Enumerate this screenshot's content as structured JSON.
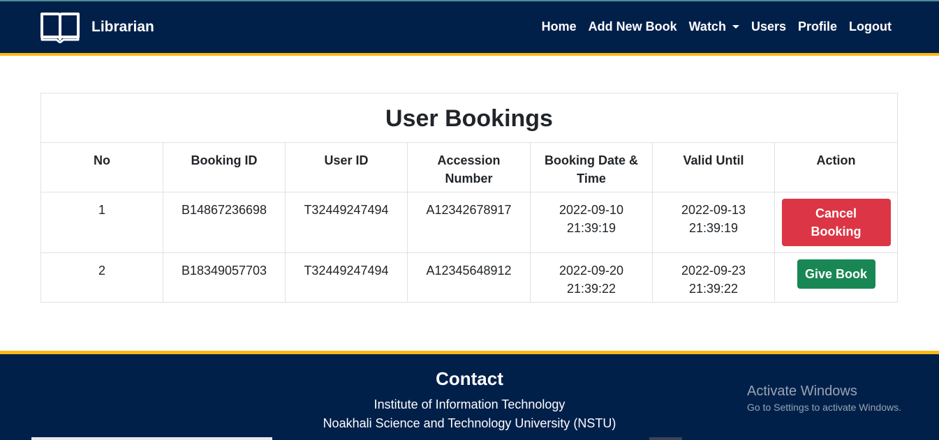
{
  "brand": {
    "title": "Librarian",
    "icon": "open-book-icon"
  },
  "nav": {
    "home": "Home",
    "add_new_book": "Add New Book",
    "watch": "Watch",
    "users": "Users",
    "profile": "Profile",
    "logout": "Logout"
  },
  "table": {
    "title": "User Bookings",
    "columns": [
      "No",
      "Booking ID",
      "User ID",
      "Accession Number",
      "Booking Date & Time",
      "Valid Until",
      "Action"
    ],
    "rows": [
      {
        "no": "1",
        "booking_id": "B14867236698",
        "user_id": "T32449247494",
        "accession_number": "A12342678917",
        "booking_date": "2022-09-10",
        "booking_time": "21:39:19",
        "valid_date": "2022-09-13",
        "valid_time": "21:39:19",
        "action": "Cancel Booking"
      },
      {
        "no": "2",
        "booking_id": "B18349057703",
        "user_id": "T32449247494",
        "accession_number": "A12345648912",
        "booking_date": "2022-09-20",
        "booking_time": "21:39:22",
        "valid_date": "2022-09-23",
        "valid_time": "21:39:22",
        "action": "Give Book"
      }
    ]
  },
  "footer": {
    "title": "Contact",
    "line1": "Institute of Information Technology",
    "line2": "Noakhali Science and Technology University (NSTU)"
  },
  "watermark": {
    "title": "Activate Windows",
    "subtitle": "Go to Settings to activate Windows."
  },
  "colors": {
    "navbar": "#00204a",
    "accent_stripe": "#fdb813",
    "danger": "#dc3545",
    "success": "#198754"
  }
}
